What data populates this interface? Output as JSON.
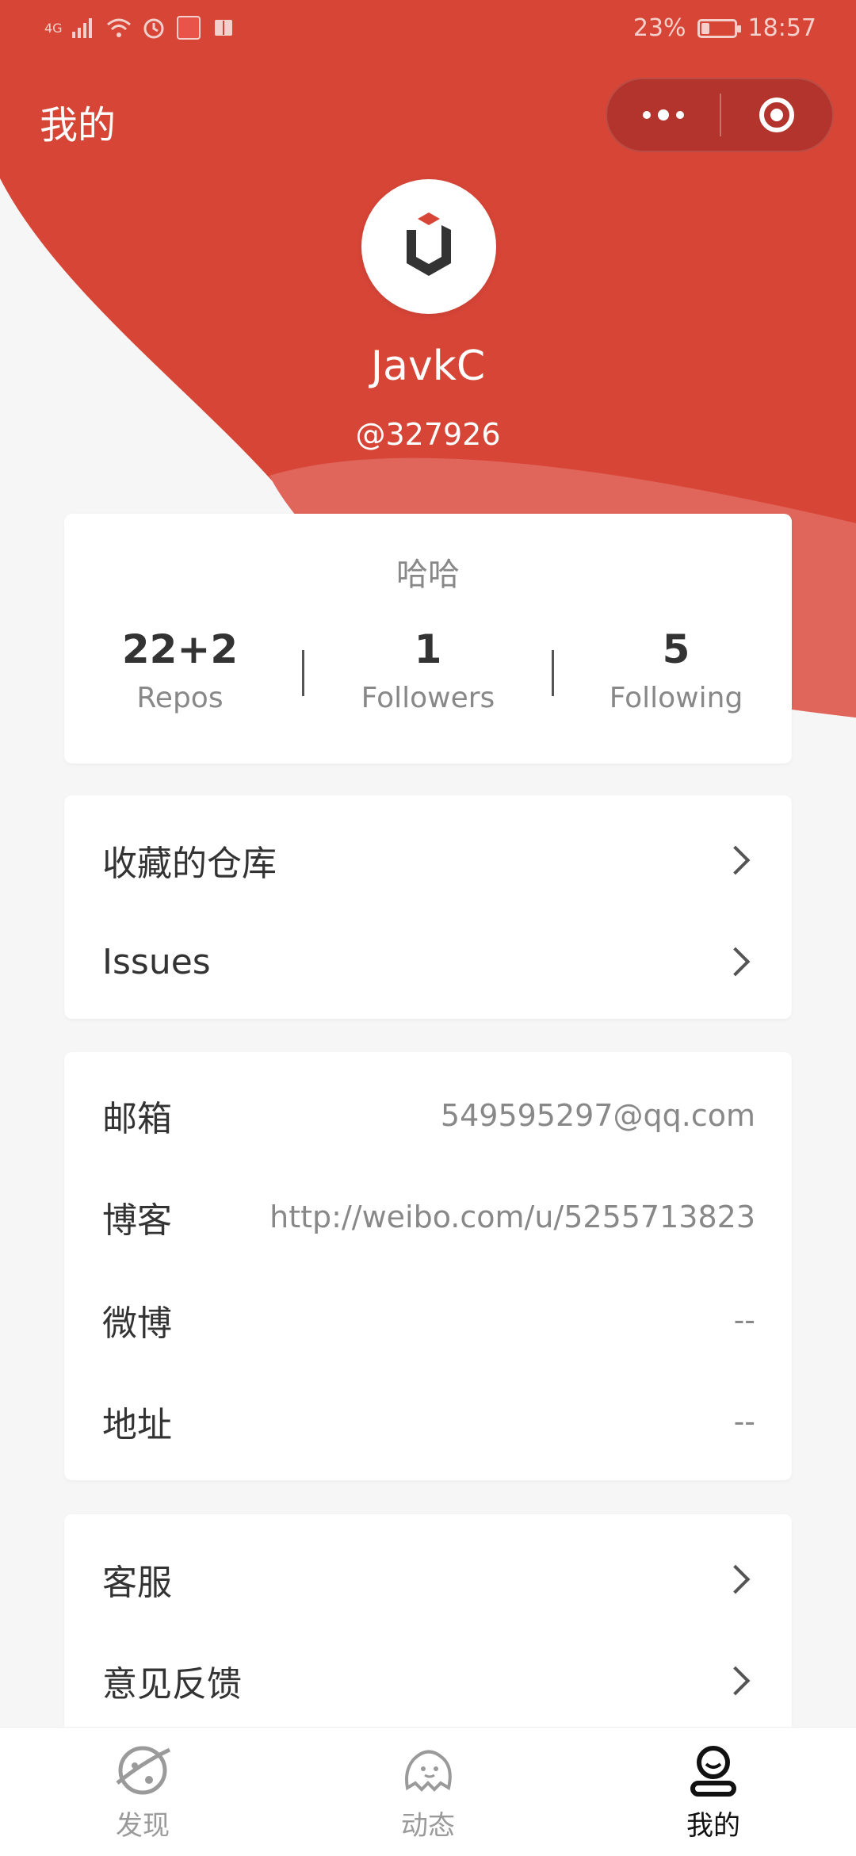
{
  "status_bar": {
    "network": "4G",
    "battery_percent": "23%",
    "battery_level": 0.23,
    "time": "18:57"
  },
  "header": {
    "title": "我的",
    "more_icon": "more-dots-icon",
    "close_icon": "close-target-icon"
  },
  "profile": {
    "name": "JavkC",
    "handle": "@327926",
    "avatar_icon": "cube-logo-icon"
  },
  "stats": {
    "bio": "哈哈",
    "items": [
      {
        "value": "22+2",
        "label": "Repos"
      },
      {
        "value": "1",
        "label": "Followers"
      },
      {
        "value": "5",
        "label": "Following"
      }
    ]
  },
  "links": [
    {
      "label": "收藏的仓库"
    },
    {
      "label": "Issues"
    }
  ],
  "info": [
    {
      "label": "邮箱",
      "value": "549595297@qq.com"
    },
    {
      "label": "博客",
      "value": "http://weibo.com/u/5255713823"
    },
    {
      "label": "微博",
      "value": "--"
    },
    {
      "label": "地址",
      "value": "--"
    }
  ],
  "services": [
    {
      "label": "客服"
    },
    {
      "label": "意见反馈"
    }
  ],
  "tabbar": {
    "items": [
      {
        "label": "发现",
        "icon": "planet-icon",
        "active": false
      },
      {
        "label": "动态",
        "icon": "ghost-icon",
        "active": false
      },
      {
        "label": "我的",
        "icon": "user-icon",
        "active": true
      }
    ]
  },
  "colors": {
    "accent": "#d74537",
    "accent_light": "#e0655b",
    "capsule": "#b2342c",
    "background": "#f6f6f6"
  }
}
